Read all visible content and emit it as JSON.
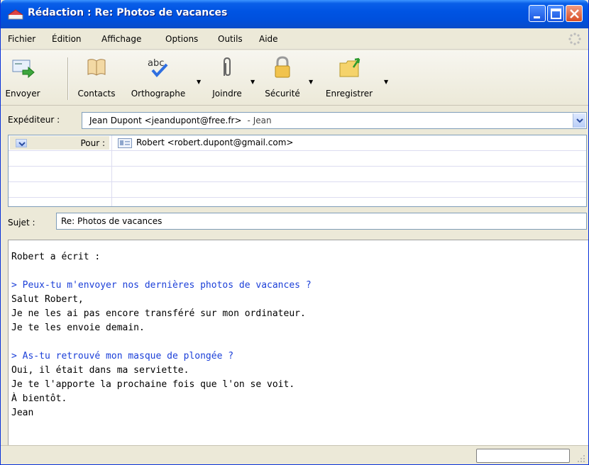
{
  "window": {
    "title": "Rédaction : Re: Photos de vacances"
  },
  "menu": {
    "items": [
      "Fichier",
      "Édition",
      "Affichage",
      "Options",
      "Outils",
      "Aide"
    ]
  },
  "toolbar": {
    "send": "Envoyer",
    "contacts": "Contacts",
    "spelling": "Orthographe",
    "attach": "Joindre",
    "security": "Sécurité",
    "save": "Enregistrer"
  },
  "sender": {
    "label": "Expéditeur :",
    "value": "Jean Dupont <jeandupont@free.fr>",
    "suffix": "- Jean"
  },
  "recipients": [
    {
      "type": "Pour :",
      "address": "Robert <robert.dupont@gmail.com>"
    }
  ],
  "subject": {
    "label": "Sujet :",
    "value": "Re: Photos de vacances"
  },
  "body": {
    "lines": [
      {
        "text": "Robert a écrit :",
        "quoted": false
      },
      {
        "text": "",
        "quoted": false
      },
      {
        "text": "> Peux-tu m'envoyer nos dernières photos de vacances ?",
        "quoted": true
      },
      {
        "text": "Salut Robert,",
        "quoted": false
      },
      {
        "text": "Je ne les ai pas encore transféré sur mon ordinateur.",
        "quoted": false
      },
      {
        "text": "Je te les envoie demain.",
        "quoted": false
      },
      {
        "text": "",
        "quoted": false
      },
      {
        "text": "> As-tu retrouvé mon masque de plongée ?",
        "quoted": true
      },
      {
        "text": "Oui, il était dans ma serviette.",
        "quoted": false
      },
      {
        "text": "Je te l'apporte la prochaine fois que l'on se voit.",
        "quoted": false
      },
      {
        "text": "À bientôt.",
        "quoted": false
      },
      {
        "text": "Jean",
        "quoted": false
      }
    ]
  },
  "colors": {
    "titlebar": "#0054e3",
    "quote": "#1b3fd8",
    "chrome": "#ece9d8"
  },
  "icons": {
    "send": "send-icon",
    "contacts": "address-book-icon",
    "spelling": "spellcheck-icon",
    "attach": "paperclip-icon",
    "security": "padlock-icon",
    "save": "save-folder-icon"
  }
}
